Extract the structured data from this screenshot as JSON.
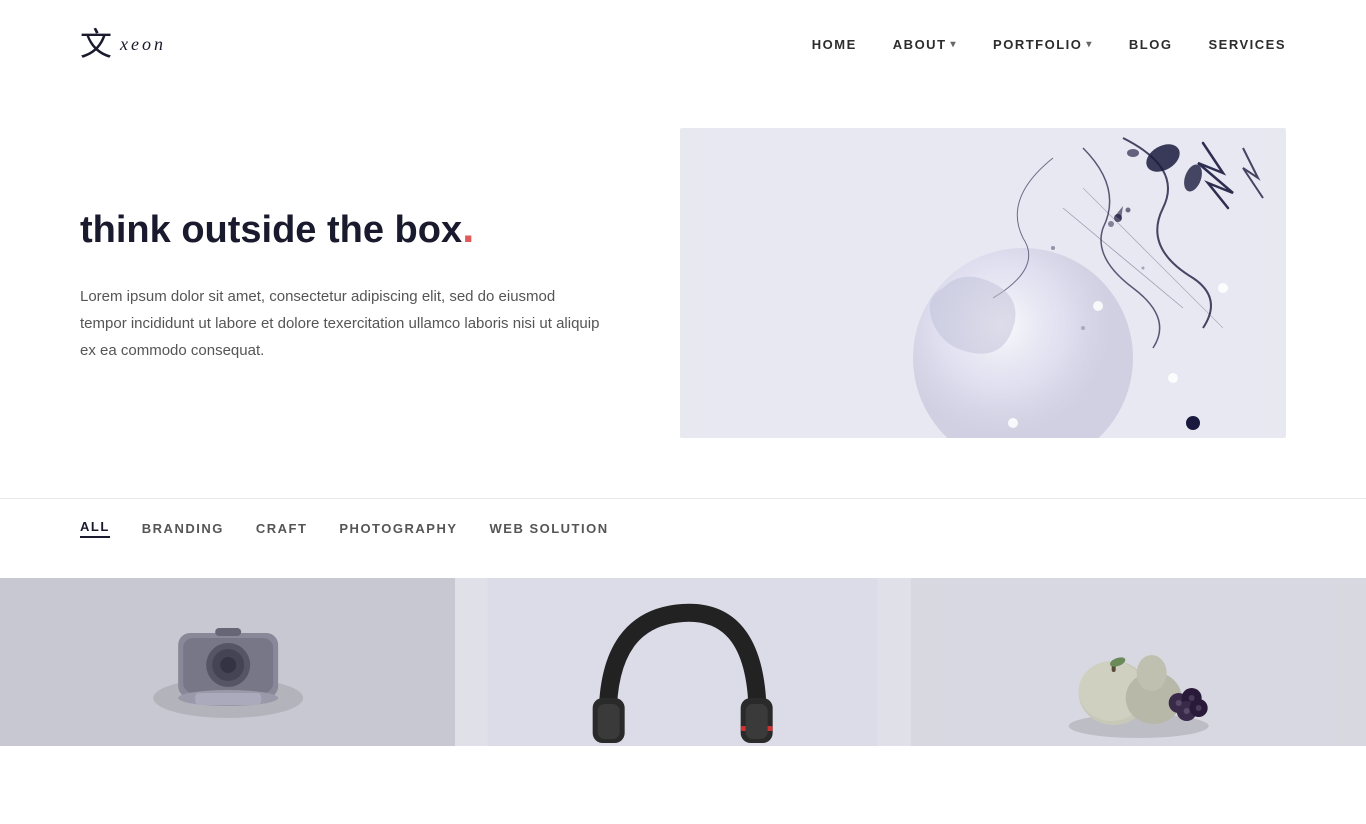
{
  "header": {
    "logo_symbol": "文",
    "logo_text": "xeon",
    "nav": {
      "items": [
        {
          "label": "HOME",
          "has_caret": false,
          "id": "home"
        },
        {
          "label": "ABOUT",
          "has_caret": true,
          "id": "about"
        },
        {
          "label": "PORTFOLIO",
          "has_caret": true,
          "id": "portfolio"
        },
        {
          "label": "BLOG",
          "has_caret": false,
          "id": "blog"
        },
        {
          "label": "SERVICES",
          "has_caret": false,
          "id": "services"
        }
      ]
    }
  },
  "hero": {
    "title": "think outside the box",
    "title_dot": ".",
    "description": "Lorem ipsum dolor sit amet, consectetur adipiscing elit, sed do eiusmod tempor incididunt ut labore et dolore texercitation ullamco laboris nisi ut aliquip ex ea commodo consequat."
  },
  "filter": {
    "items": [
      {
        "label": "ALL",
        "active": true,
        "id": "all"
      },
      {
        "label": "BRANDING",
        "active": false,
        "id": "branding"
      },
      {
        "label": "CRAFT",
        "active": false,
        "id": "craft"
      },
      {
        "label": "PHOTOGRAPHY",
        "active": false,
        "id": "photography"
      },
      {
        "label": "WEB SOLUTION",
        "active": false,
        "id": "web-solution"
      }
    ]
  },
  "portfolio": {
    "items": [
      {
        "id": "item-1",
        "type": "speaker"
      },
      {
        "id": "item-2",
        "type": "headphones"
      },
      {
        "id": "item-3",
        "type": "fruits"
      }
    ]
  },
  "colors": {
    "accent_red": "#e05a5a",
    "dark_navy": "#1a1a2e",
    "hero_bg": "#e8e8f0"
  }
}
